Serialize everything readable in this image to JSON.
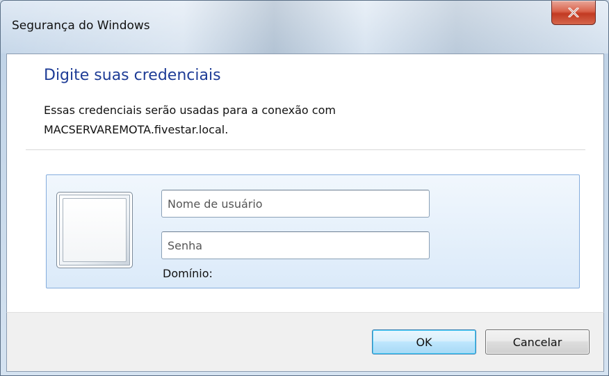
{
  "window": {
    "title": "Segurança do Windows",
    "close_label": "x"
  },
  "main": {
    "heading": "Digite suas credenciais",
    "description_line1": "Essas credenciais serão usadas para a conexão com",
    "description_line2": "MACSERVAREMOTA.fivestar.local."
  },
  "credentials": {
    "username_placeholder": "Nome de usuário",
    "username_value": "",
    "password_placeholder": "Senha",
    "password_value": "",
    "domain_label": "Domínio:"
  },
  "buttons": {
    "ok_label": "OK",
    "cancel_label": "Cancelar"
  },
  "colors": {
    "heading": "#1e3c96",
    "tile_border": "#84acdd",
    "close_button": "#c23a22"
  },
  "icons": {
    "close": "close-icon",
    "user_tile": "user-tile-icon"
  }
}
